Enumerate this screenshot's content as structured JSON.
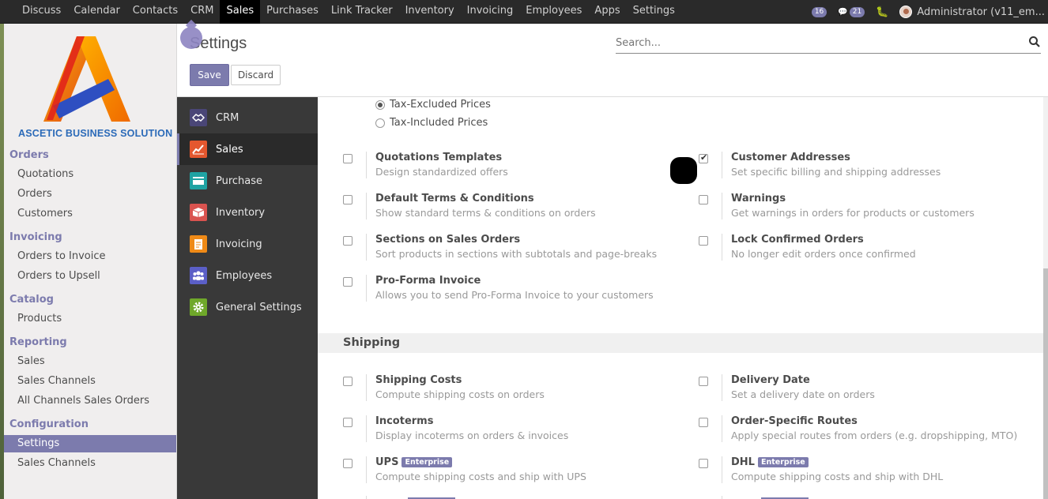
{
  "topnav": {
    "menu": [
      "Discuss",
      "Calendar",
      "Contacts",
      "CRM",
      "Sales",
      "Purchases",
      "Link Tracker",
      "Inventory",
      "Invoicing",
      "Employees",
      "Apps",
      "Settings"
    ],
    "active_menu": "Sales",
    "messages_count": "16",
    "chat_count": "21",
    "user": "Administrator (v11_em..."
  },
  "sidebar": {
    "logo_text": "ASCETIC BUSINESS SOLUTION",
    "sections": [
      {
        "title": "Orders",
        "items": [
          "Quotations",
          "Orders",
          "Customers"
        ]
      },
      {
        "title": "Invoicing",
        "items": [
          "Orders to Invoice",
          "Orders to Upsell"
        ]
      },
      {
        "title": "Catalog",
        "items": [
          "Products"
        ]
      },
      {
        "title": "Reporting",
        "items": [
          "Sales",
          "Sales Channels",
          "All Channels Sales Orders"
        ]
      },
      {
        "title": "Configuration",
        "items": [
          "Settings",
          "Sales Channels"
        ]
      }
    ],
    "active_item": "Settings"
  },
  "control_panel": {
    "title": "Settings",
    "search_placeholder": "Search...",
    "save_label": "Save",
    "discard_label": "Discard"
  },
  "apps": {
    "items": [
      {
        "label": "CRM",
        "icon": "handshake-icon",
        "color": "#4a4677"
      },
      {
        "label": "Sales",
        "icon": "chart-line-icon",
        "color": "#e4572e"
      },
      {
        "label": "Purchase",
        "icon": "credit-card-icon",
        "color": "#1fa3a3"
      },
      {
        "label": "Inventory",
        "icon": "cube-icon",
        "color": "#d9534f"
      },
      {
        "label": "Invoicing",
        "icon": "document-icon",
        "color": "#ef8a17"
      },
      {
        "label": "Employees",
        "icon": "users-icon",
        "color": "#5b5fc7"
      },
      {
        "label": "General Settings",
        "icon": "gear-icon",
        "color": "#6fa82a"
      }
    ],
    "active": "Sales"
  },
  "pricing_radio": [
    {
      "label": "Tax-Excluded Prices",
      "checked": true
    },
    {
      "label": "Tax-Included Prices",
      "checked": false
    }
  ],
  "quotation_settings": [
    {
      "title": "Quotations Templates",
      "desc": "Design standardized offers",
      "checked": false
    },
    {
      "title": "Customer Addresses",
      "desc": "Set specific billing and shipping addresses",
      "checked": true
    },
    {
      "title": "Default Terms & Conditions",
      "desc": "Show standard terms & conditions on orders",
      "checked": false
    },
    {
      "title": "Warnings",
      "desc": "Get warnings in orders for products or customers",
      "checked": false
    },
    {
      "title": "Sections on Sales Orders",
      "desc": "Sort products in sections with subtotals and page-breaks",
      "checked": false
    },
    {
      "title": "Lock Confirmed Orders",
      "desc": "No longer edit orders once confirmed",
      "checked": false
    },
    {
      "title": "Pro-Forma Invoice",
      "desc": "Allows you to send Pro-Forma Invoice to your customers",
      "checked": false
    }
  ],
  "shipping": {
    "heading": "Shipping",
    "enterprise_label": "Enterprise",
    "settings": [
      {
        "title": "Shipping Costs",
        "desc": "Compute shipping costs on orders",
        "checked": false,
        "enterprise": false
      },
      {
        "title": "Delivery Date",
        "desc": "Set a delivery date on orders",
        "checked": false,
        "enterprise": false
      },
      {
        "title": "Incoterms",
        "desc": "Display incoterms on orders & invoices",
        "checked": false,
        "enterprise": false
      },
      {
        "title": "Order-Specific Routes",
        "desc": "Apply special routes from orders (e.g. dropshipping, MTO)",
        "checked": false,
        "enterprise": false
      },
      {
        "title": "UPS",
        "desc": "Compute shipping costs and ship with UPS",
        "checked": false,
        "enterprise": true
      },
      {
        "title": "DHL",
        "desc": "Compute shipping costs and ship with DHL",
        "checked": false,
        "enterprise": true
      }
    ]
  }
}
